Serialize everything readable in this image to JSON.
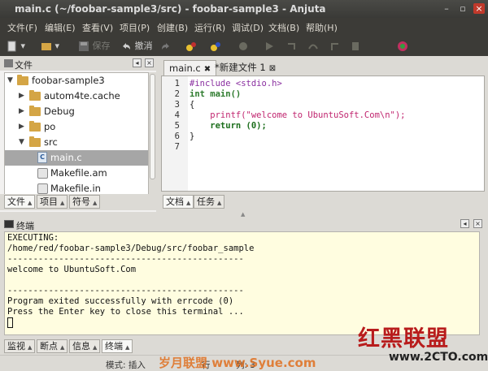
{
  "window": {
    "title": "main.c (~/foobar-sample3/src) - foobar-sample3 - Anjuta"
  },
  "menubar": [
    "文件(F)",
    "编辑(E)",
    "查看(V)",
    "项目(P)",
    "创建(B)",
    "运行(R)",
    "调试(D)",
    "文档(B)",
    "帮助(H)"
  ],
  "toolbar": {
    "save_label": "保存",
    "undo_label": "撤消"
  },
  "file_panel": {
    "title": "文件",
    "tree": [
      {
        "label": "foobar-sample3",
        "type": "folder",
        "expanded": true,
        "depth": 0
      },
      {
        "label": "autom4te.cache",
        "type": "folder",
        "expanded": false,
        "depth": 1
      },
      {
        "label": "Debug",
        "type": "folder",
        "expanded": false,
        "depth": 1
      },
      {
        "label": "po",
        "type": "folder",
        "expanded": false,
        "depth": 1
      },
      {
        "label": "src",
        "type": "folder",
        "expanded": true,
        "depth": 1
      },
      {
        "label": "main.c",
        "type": "c-file",
        "selected": true,
        "depth": 2
      },
      {
        "label": "Makefile.am",
        "type": "make-file",
        "depth": 2
      },
      {
        "label": "Makefile.in",
        "type": "make-file",
        "depth": 2
      }
    ],
    "tabs": [
      "文件",
      "项目",
      "符号"
    ]
  },
  "editor": {
    "tabs": [
      {
        "label": "main.c",
        "active": true
      },
      {
        "label": "*新建文件 1",
        "active": false
      }
    ],
    "lines": [
      {
        "n": "1",
        "text": "#include <stdio.h>"
      },
      {
        "n": "2",
        "text": "int main()"
      },
      {
        "n": "3",
        "text": "{"
      },
      {
        "n": "4",
        "text": "    printf(\"welcome to UbuntuSoft.Com\\n\");"
      },
      {
        "n": "5",
        "text": "    return (0);"
      },
      {
        "n": "6",
        "text": "}"
      },
      {
        "n": "7",
        "text": ""
      }
    ],
    "bottom_tabs": [
      "文档",
      "任务"
    ]
  },
  "terminal": {
    "title": "终端",
    "lines": [
      "EXECUTING:",
      "/home/red/foobar-sample3/Debug/src/foobar_sample",
      "----------------------------------------------",
      "welcome to UbuntuSoft.Com",
      "",
      "----------------------------------------------",
      "Program exited successfully with errcode (0)",
      "Press the Enter key to close this terminal ..."
    ],
    "tabs": [
      "监视",
      "断点",
      "信息",
      "终端"
    ]
  },
  "statusbar": {
    "mode": "模式: 插入",
    "line_col": "行",
    "col": "列: 3"
  },
  "watermarks": {
    "brand": "红黑联盟",
    "site": "www.2CTO.com",
    "overlay": "岁月联盟 www.Syue.com"
  },
  "colors": {
    "accent_red": "#b81c1c",
    "terminal_bg": "#fffde0",
    "titlebar": "#3c3b37"
  }
}
